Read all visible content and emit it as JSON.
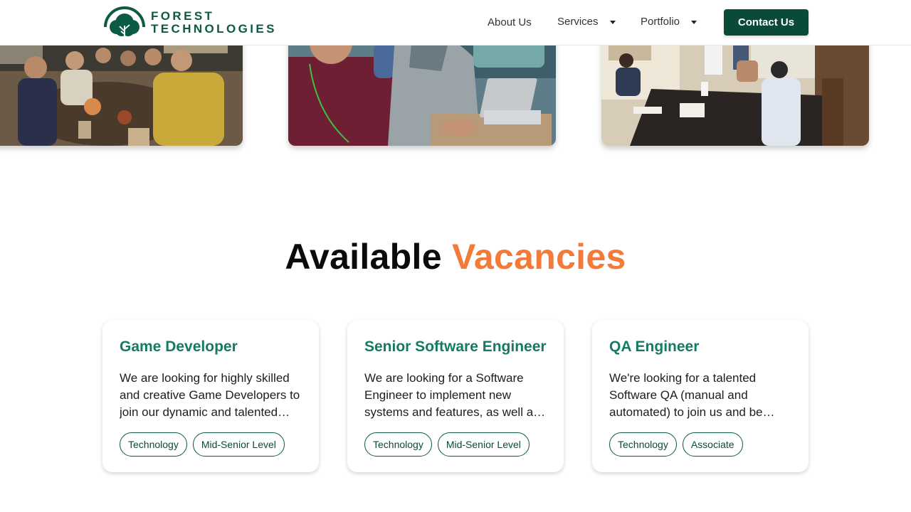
{
  "brand": {
    "line1": "FOREST",
    "line2": "TECHNOLOGIES",
    "color": "#0b5a45",
    "icon": "tree-logo-icon"
  },
  "nav": {
    "about": "About Us",
    "services": "Services",
    "portfolio": "Portfolio",
    "contact": "Contact Us"
  },
  "photos": [
    {
      "name": "team-dinner-photo"
    },
    {
      "name": "team-working-photo"
    },
    {
      "name": "team-meeting-photo"
    }
  ],
  "section": {
    "title_part1": "Available",
    "title_part2": "Vacancies",
    "accent_color": "#f47a3a"
  },
  "vacancies": [
    {
      "title": "Game Developer",
      "description": "We are looking for highly skilled and creative Game Developers to join our dynamic and talented…",
      "tags": [
        "Technology",
        "Mid-Senior Level"
      ]
    },
    {
      "title": "Senior Software Engineer",
      "description": "We are looking for a Software Engineer to implement new systems and features, as well a…",
      "tags": [
        "Technology",
        "Mid-Senior Level"
      ]
    },
    {
      "title": "QA Engineer",
      "description": "We're looking for a talented Software QA (manual and automated) to join us and be…",
      "tags": [
        "Technology",
        "Associate"
      ]
    }
  ]
}
